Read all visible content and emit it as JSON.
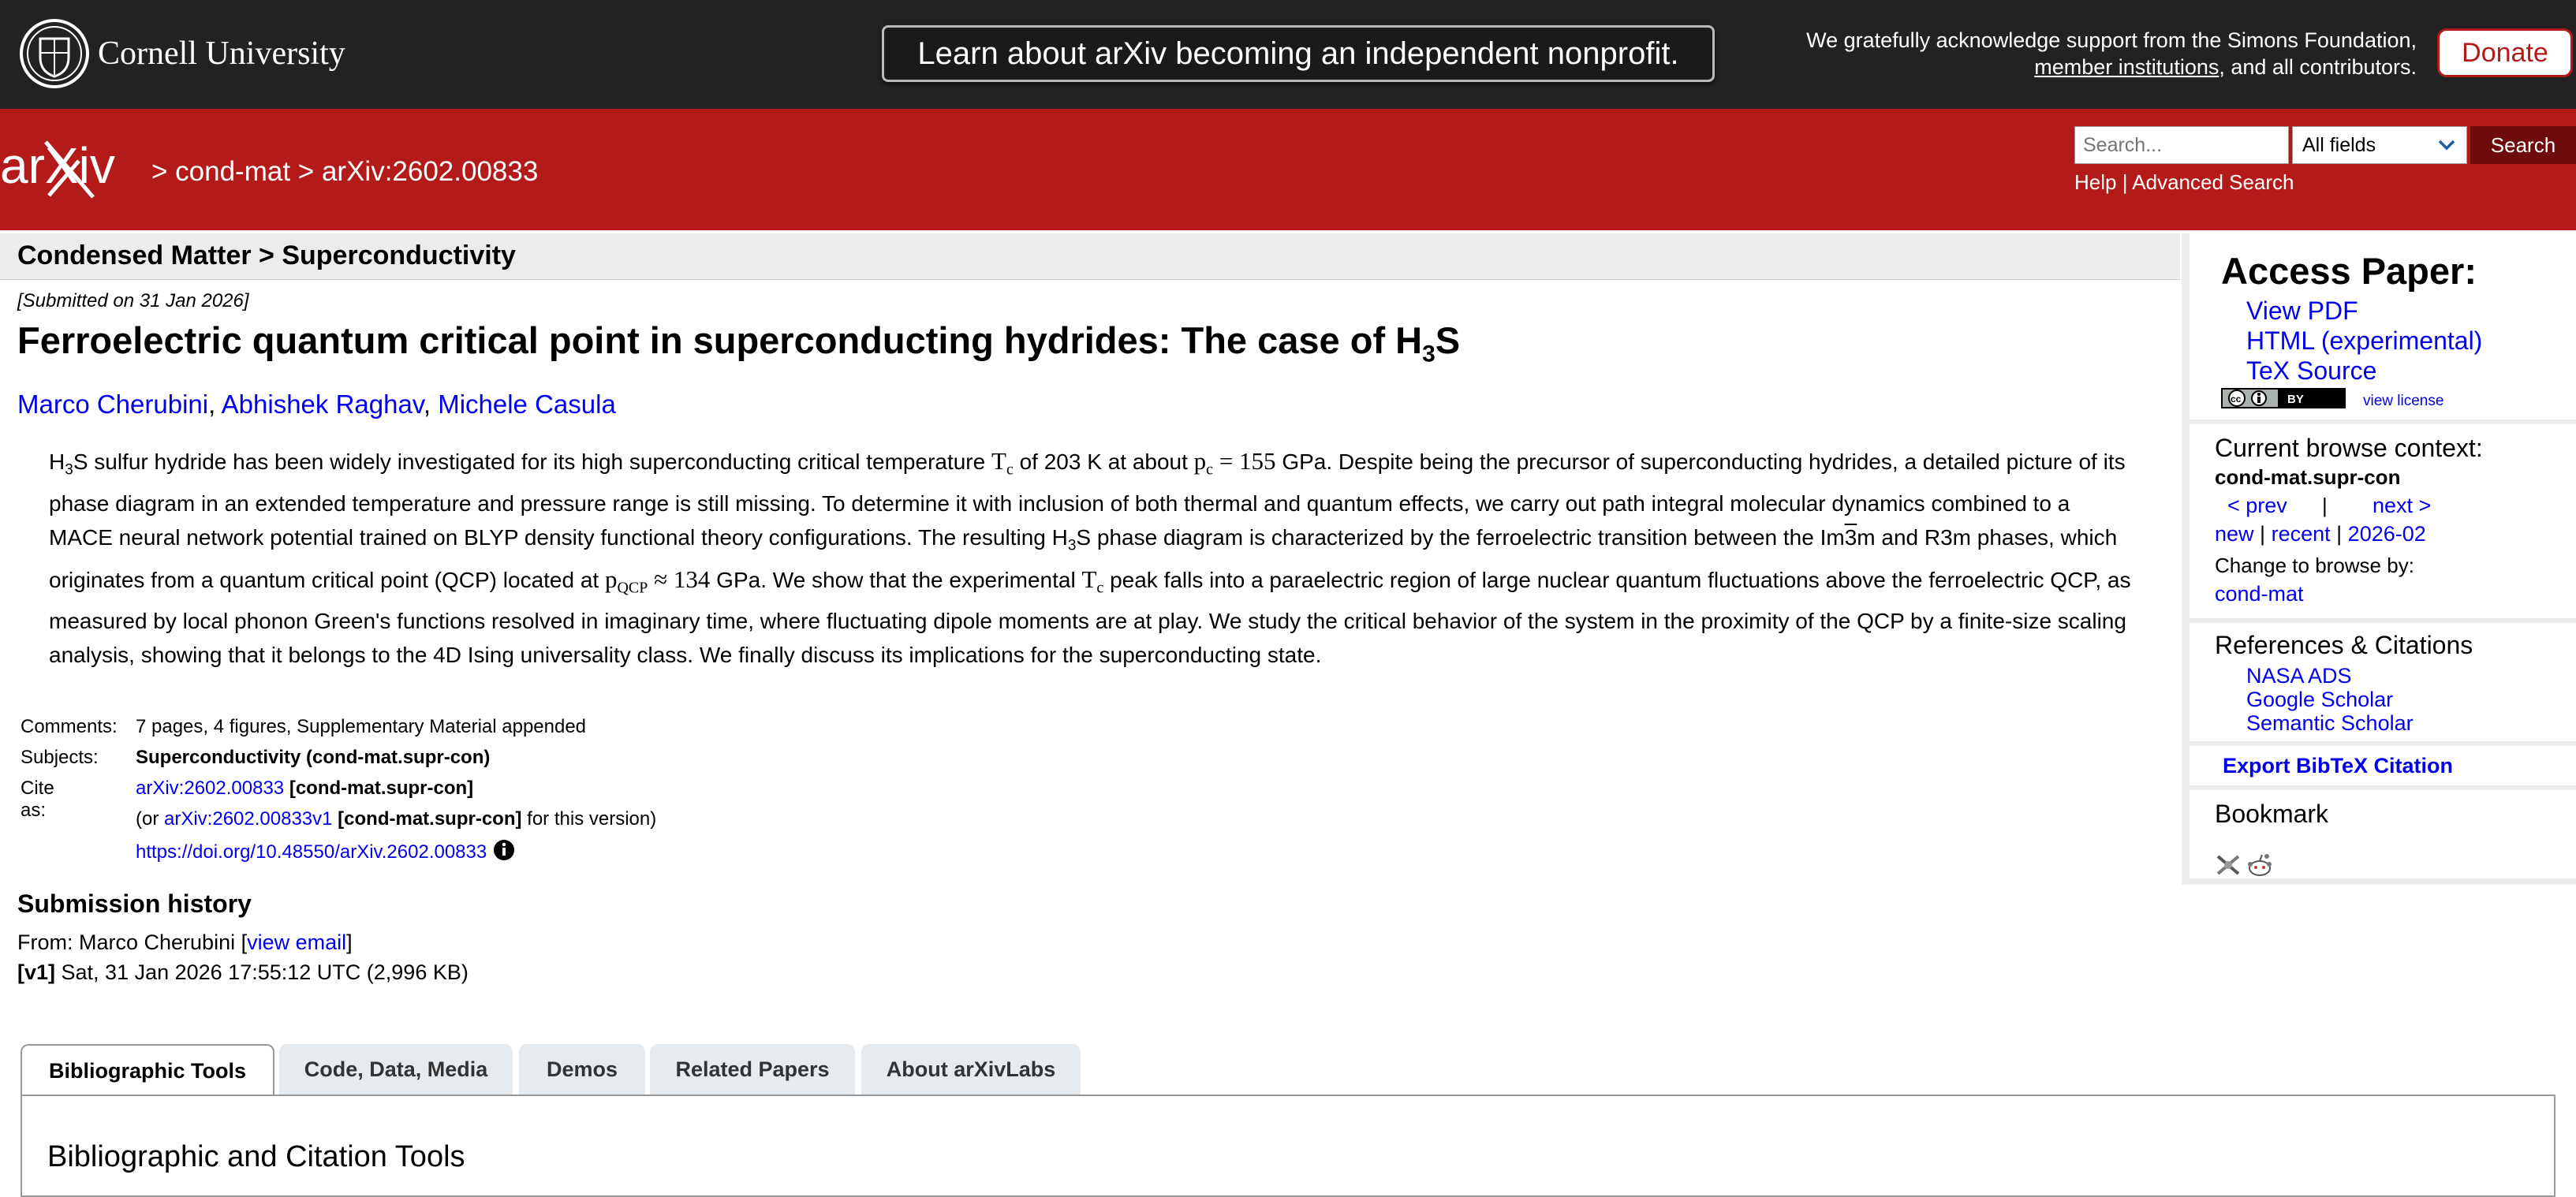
{
  "topbar": {
    "institution": "Cornell University",
    "banner_button": "Learn about arXiv becoming an independent nonprofit.",
    "support_line1": "We gratefully acknowledge support from the Simons Foundation,",
    "support_link": "member institutions",
    "support_line2_rest": ", and all contributors.",
    "donate_label": "Donate"
  },
  "header": {
    "logo_text": "arXiv",
    "breadcrumb": "> cond-mat > arXiv:2602.00833",
    "search_placeholder": "Search...",
    "search_field": "All fields",
    "search_button": "Search",
    "help_link": "Help",
    "help_separator": " | ",
    "advanced_link": "Advanced Search"
  },
  "paper": {
    "subject_heading": "Condensed Matter > Superconductivity",
    "submitted": "[Submitted on 31 Jan 2026]",
    "title_main": "Ferroelectric quantum critical point in superconducting hydrides: The case of H",
    "title_sub": "3",
    "title_end": "S",
    "authors": [
      "Marco Cherubini",
      "Abhishek Raghav",
      "Michele Casula"
    ],
    "abstract": {
      "s1a": "H",
      "s1b": "3",
      "s1c": "S sulfur hydride has been widely investigated for its high superconducting critical temperature ",
      "tc1": "T",
      "tc1sub": "c",
      "s2": " of 203 K at about ",
      "pc": "p",
      "pcsub": "c",
      "pcval": " = 155",
      "s3": " GPa. Despite being the precursor of superconducting hydrides, a detailed picture of its phase diagram in an extended temperature and pressure range is still missing. To determine it with inclusion of both thermal and quantum effects, we carry out path integral molecular dynamics combined to a MACE neural network potential trained on BLYP density functional theory configurations. The resulting H",
      "s3sub": "3",
      "s4": "S phase diagram is characterized by the ferroelectric transition between the Im",
      "bar3": "3",
      "s5": "m and R3m phases, which originates from a quantum critical point (QCP) located at ",
      "pq": "p",
      "pqsub": "QCP",
      "pqval": " ≈ 134",
      "s6": " GPa. We show that the experimental ",
      "tc2": "T",
      "tc2sub": "c",
      "s7": " peak falls into a paraelectric region of large nuclear quantum fluctuations above the ferroelectric QCP, as measured by local phonon Green's functions resolved in imaginary time, where fluctuating dipole moments are at play. We study the critical behavior of the system in the proximity of the QCP by a finite-size scaling analysis, showing that it belongs to the 4D Ising universality class. We finally discuss its implications for the superconducting state."
    },
    "meta": {
      "comments_label": "Comments:",
      "comments": "7 pages, 4 figures, Supplementary Material appended",
      "subjects_label": "Subjects:",
      "subjects": "Superconductivity (cond-mat.supr-con)",
      "cite_label": "Cite as:",
      "cite_id": "arXiv:2602.00833",
      "cite_cat": " [cond-mat.supr-con]",
      "version_pre": "(or ",
      "version_id": "arXiv:2602.00833v1",
      "version_cat": " [cond-mat.supr-con]",
      "version_post": " for this version)",
      "doi": "https://doi.org/10.48550/arXiv.2602.00833"
    },
    "history": {
      "title": "Submission history",
      "from_pre": "From: Marco Cherubini [",
      "view_email": "view email",
      "from_post": "]",
      "v1_label": "[v1]",
      "v1_text": " Sat, 31 Jan 2026 17:55:12 UTC (2,996 KB)"
    }
  },
  "tabs": {
    "items": [
      "Bibliographic Tools",
      "Code, Data, Media",
      "Demos",
      "Related Papers",
      "About arXivLabs"
    ],
    "panel_title": "Bibliographic and Citation Tools"
  },
  "sidebar": {
    "access_title": "Access Paper:",
    "view_pdf": "View PDF",
    "html": "HTML (experimental)",
    "tex": "TeX Source",
    "view_license": "view license",
    "browse_title": "Current browse context:",
    "context": "cond-mat.supr-con",
    "prev": "< prev",
    "sep": "|",
    "next": "next >",
    "new": "new",
    "recent": "recent",
    "month": "2026-02",
    "pipe": "|",
    "change_label": "Change to browse by:",
    "change_link": "cond-mat",
    "refs_title": "References & Citations",
    "nasa": "NASA ADS",
    "google": "Google Scholar",
    "semantic": "Semantic Scholar",
    "bibtex": "Export BibTeX Citation",
    "bookmark_title": "Bookmark"
  },
  "colors": {
    "arxiv_red": "#b31b1b",
    "topbar": "#222222",
    "link": "#0000ee",
    "search_button": "#6e0c0c"
  }
}
